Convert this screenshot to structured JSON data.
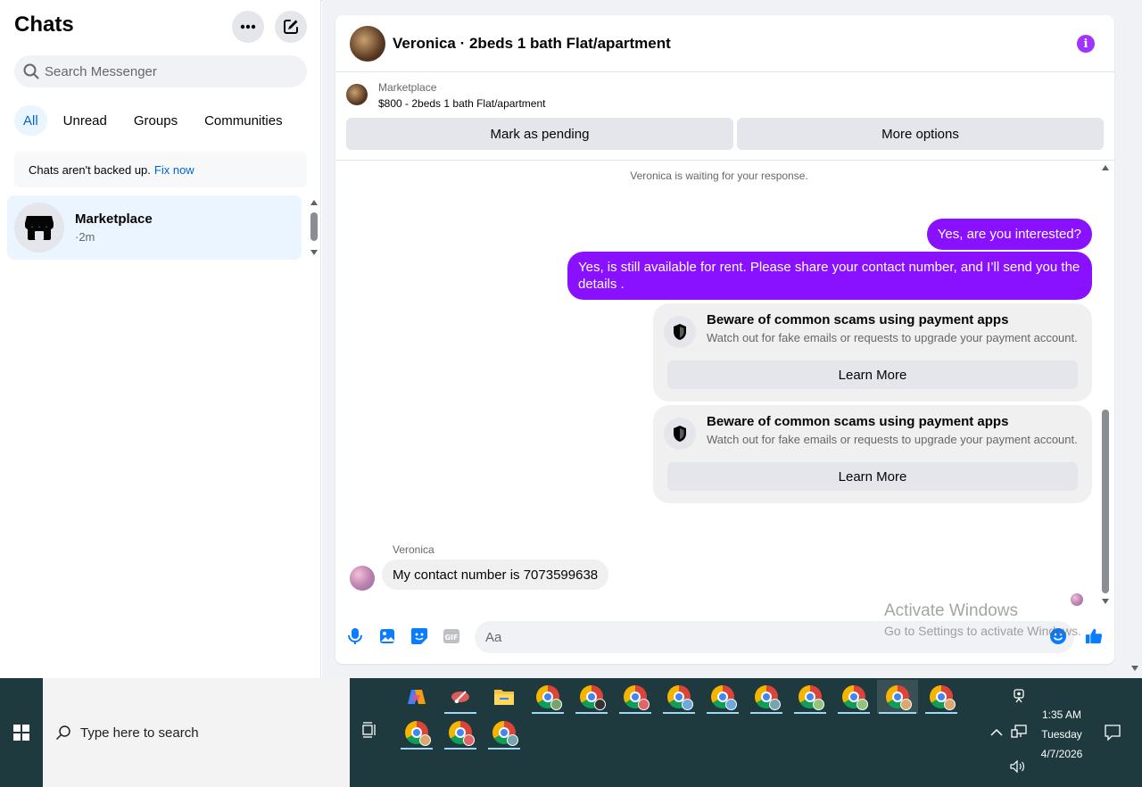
{
  "sidebar": {
    "title": "Chats",
    "search_placeholder": "Search Messenger",
    "filters": [
      "All",
      "Unread",
      "Groups",
      "Communities"
    ],
    "backup_text": "Chats aren't backed up.",
    "backup_link": "Fix now",
    "chats": [
      {
        "name": "Marketplace",
        "time": "·2m"
      }
    ]
  },
  "conversation": {
    "title": "Veronica · 2beds 1 bath Flat/apartment",
    "marketplace_label": "Marketplace",
    "listing": "$800 - 2beds 1 bath Flat/apartment",
    "mark_pending": "Mark as pending",
    "more_options": "More options",
    "waiting_text": "Veronica is waiting for your response.",
    "outgoing": [
      "Yes, are you interested?",
      "Yes, is still available for rent. Please share your contact number, and I’ll send you the details ."
    ],
    "warnings": [
      {
        "title": "Beware of common scams using payment apps",
        "text": "Watch out for fake emails or requests to upgrade your payment account.",
        "button": "Learn More"
      },
      {
        "title": "Beware of common scams using payment apps",
        "text": "Watch out for fake emails or requests to upgrade your payment account.",
        "button": "Learn More"
      }
    ],
    "sender_name": "Veronica",
    "incoming": "My contact number is 7073599638",
    "composer_placeholder": "Aa"
  },
  "watermark": {
    "line1": "Activate Windows",
    "line2": "Go to Settings to activate Windows."
  },
  "taskbar": {
    "search_placeholder": "Type here to search",
    "time": "1:35 AM",
    "day": "Tuesday",
    "date": "4/7/2026"
  },
  "colors": {
    "accent_purple": "#8a11ff",
    "link_blue": "#0064d1",
    "taskbar": "#1e3a3e"
  }
}
